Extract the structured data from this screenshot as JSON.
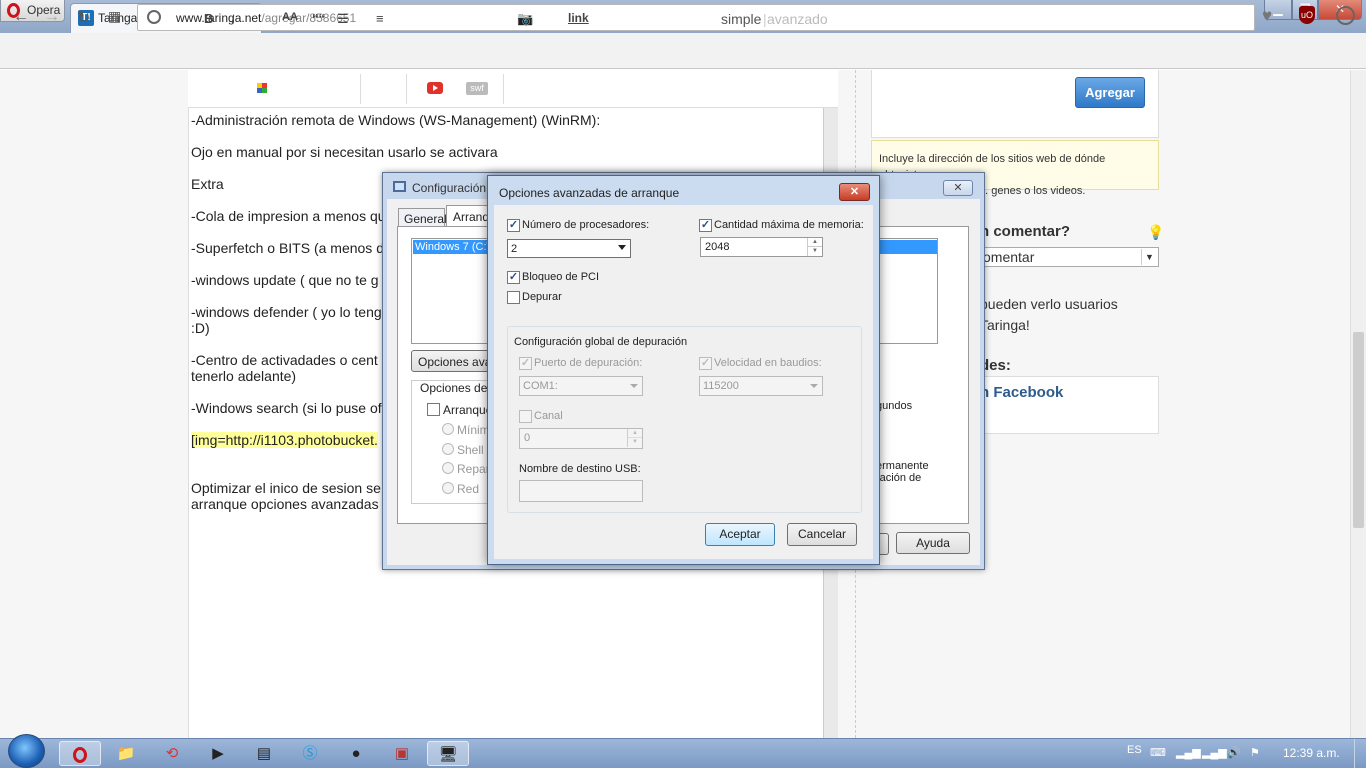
{
  "browser": {
    "menu_label": "Opera",
    "tab_title": "Taringa! - Inteligencia cole",
    "tab_favicon": "T!",
    "url_domain": "www.taringa.net",
    "url_path": "/agregar/8586651",
    "extension_badge": "uO"
  },
  "editor": {
    "toolbar": {
      "bold": "B",
      "italic": "i",
      "size": "AA",
      "quote": "““",
      "swf": "swf",
      "link": "link",
      "mode_simple": "simple",
      "mode_separator": "|",
      "mode_advanced": "avanzado"
    },
    "lines": [
      "-Administración remota de Windows (WS-Management) (WinRM):",
      "Ojo en manual por si necesitan usarlo se activara",
      "Extra",
      "-Cola de impresion a menos qu",
      "-Superfetch o BITS (a menos d",
      "-windows update ( que no te g",
      "-windows defender ( yo lo teng",
      ":D)",
      "-Centro de activadades o cent",
      "tenerlo adelante)",
      "-Windows search (si lo puse of",
      "[img=http://i1103.photobucket.",
      "Optimizar el inico de sesion se",
      "arranque opciones avanzadas"
    ]
  },
  "sidebar": {
    "agregar_button": "Agregar",
    "note": "Incluye la dirección de los sitios web de dónde obtuviste",
    "note_line2": "... genes o los videos.",
    "comment_heading": "n comentar?",
    "comment_select": "omentar",
    "visibility_line1": "pueden verlo usuarios",
    "visibility_line2": "Taringa!",
    "share_heading": "des:",
    "facebook": "n Facebook"
  },
  "config_dialog": {
    "title": "Configuración",
    "tab_general": "General",
    "tab_boot": "Arranque",
    "os_entry": "Windows 7 (C:\\",
    "advanced_button": "Opciones avan",
    "boot_options_label": "Opciones de a",
    "safe_boot_label": "Arranque",
    "radios": [
      "Mínimo",
      "Shell a",
      "Repar",
      "Red"
    ],
    "seconds_label": "gundos",
    "permanent_line1": "ermanente",
    "permanent_line2": "ración de",
    "help_button": "Ayuda",
    "close": "✕"
  },
  "advanced_dialog": {
    "title": "Opciones avanzadas de arranque",
    "close": "✕",
    "num_processors_label": "Número de procesadores:",
    "num_processors_checked": true,
    "num_processors_value": "2",
    "max_memory_label": "Cantidad máxima de memoria:",
    "max_memory_checked": true,
    "max_memory_value": "2048",
    "pci_lock_label": "Bloqueo de PCI",
    "pci_lock_checked": true,
    "debug_label": "Depurar",
    "debug_checked": false,
    "global_debug_group": "Configuración global de depuración",
    "debug_port_label": "Puerto de depuración:",
    "debug_port_value": "COM1:",
    "baud_rate_label": "Velocidad en baudios:",
    "baud_rate_value": "115200",
    "channel_label": "Canal",
    "channel_value": "0",
    "usb_target_label": "Nombre de destino USB:",
    "usb_target_value": "",
    "ok_button": "Aceptar",
    "cancel_button": "Cancelar"
  },
  "taskbar": {
    "language": "ES",
    "clock": "12:39 a.m."
  },
  "colors": {
    "accent": "#2f79c8",
    "selection": "#3399ff",
    "youtube_red": "#e0322a"
  }
}
